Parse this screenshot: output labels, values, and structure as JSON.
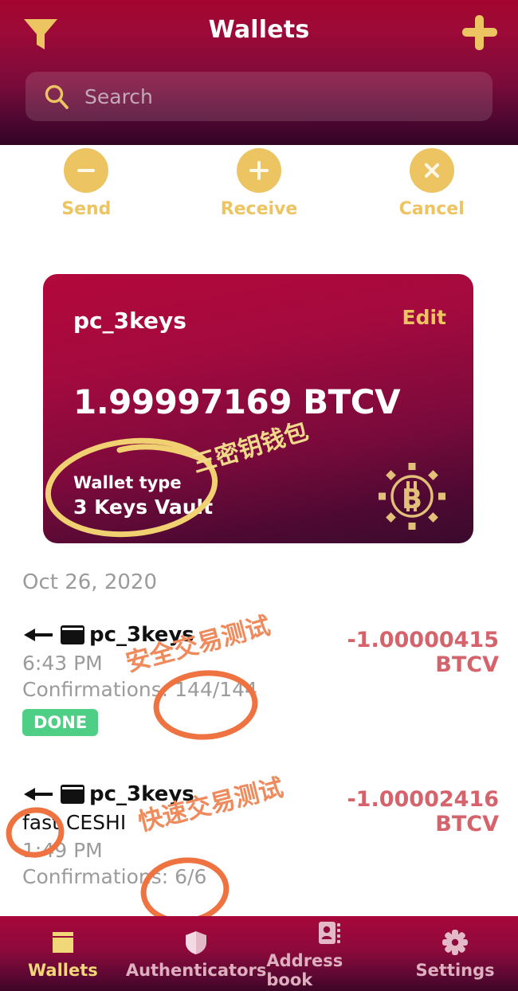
{
  "header": {
    "title": "Wallets",
    "filter_icon": "filter-funnel-icon",
    "add_icon": "plus-icon",
    "search": {
      "placeholder": "Search",
      "value": "",
      "icon": "search-icon"
    }
  },
  "actions": [
    {
      "label": "Send",
      "icon": "minus-icon"
    },
    {
      "label": "Receive",
      "icon": "plus-icon"
    },
    {
      "label": "Cancel",
      "icon": "close-x-icon"
    }
  ],
  "wallet_card": {
    "name": "pc_3keys",
    "edit_label": "Edit",
    "balance": "1.99997169 BTCV",
    "type_label": "Wallet type",
    "type_value": "3 Keys Vault",
    "logo_icon": "bitcoin-vault-logo-icon"
  },
  "transactions": {
    "date_group": "Oct 26, 2020",
    "items": [
      {
        "direction_icon": "arrow-left-icon",
        "wallet_icon": "wallet-card-icon",
        "title": "pc_3keys",
        "memo": "",
        "time": "6:43 PM",
        "confirmations": "Confirmations: 144/144",
        "status_badge": "DONE",
        "amount": "-1.00000415",
        "currency": "BTCV"
      },
      {
        "direction_icon": "arrow-left-icon",
        "wallet_icon": "wallet-card-icon",
        "title": "pc_3keys",
        "memo": "fast CESHI",
        "time": "1:49 PM",
        "confirmations": "Confirmations: 6/6",
        "status_badge": "",
        "amount": "-1.00002416",
        "currency": "BTCV"
      }
    ]
  },
  "annotations": {
    "wallet_type_note": "三密钥钱包",
    "tx1_note": "安全交易测试",
    "tx2_note": "快速交易测试"
  },
  "bottom_nav": {
    "items": [
      {
        "label": "Wallets",
        "icon": "wallets-icon",
        "active": true
      },
      {
        "label": "Authenticators",
        "icon": "shield-icon",
        "active": false
      },
      {
        "label": "Address book",
        "icon": "address-book-icon",
        "active": false
      },
      {
        "label": "Settings",
        "icon": "gear-icon",
        "active": false
      }
    ]
  },
  "colors": {
    "brand_crimson": "#a3062f",
    "gold": "#edc462",
    "card_top": "#b3083c",
    "card_bottom": "#3a0a2d",
    "amount_red": "#d4636b",
    "badge_green": "#4fcf86",
    "annotation_orange": "#ee8a5c",
    "annotation_yellow": "#f0d98a",
    "muted_grey": "#9b9b9b"
  }
}
